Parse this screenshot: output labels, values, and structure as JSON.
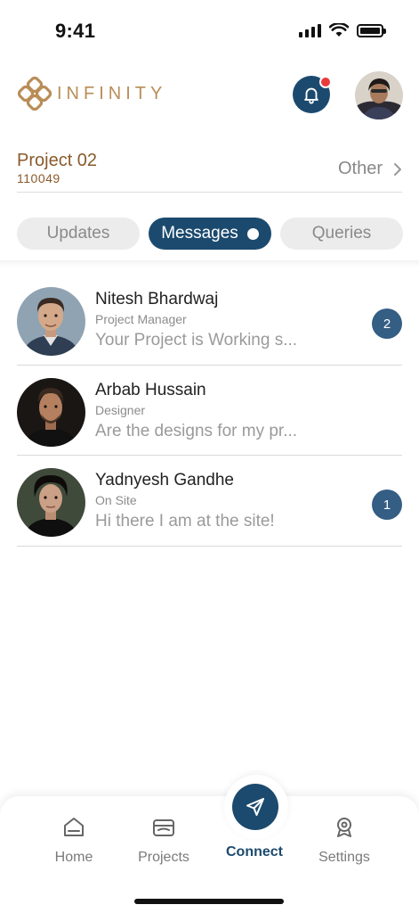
{
  "status_bar": {
    "time": "9:41"
  },
  "header": {
    "logo_text": "INFINITY",
    "notification_icon": "bell-icon",
    "has_notification": true
  },
  "project": {
    "name": "Project 02",
    "code": "110049",
    "other_label": "Other"
  },
  "tabs": [
    {
      "label": "Updates",
      "active": false
    },
    {
      "label": "Messages",
      "active": true
    },
    {
      "label": "Queries",
      "active": false
    }
  ],
  "messages": [
    {
      "name": "Nitesh Bhardwaj",
      "role": "Project Manager",
      "preview": "Your Project is Working s...",
      "unread": "2"
    },
    {
      "name": "Arbab Hussain",
      "role": "Designer",
      "preview": "Are the designs for my pr...",
      "unread": ""
    },
    {
      "name": "Yadnyesh Gandhe",
      "role": "On Site",
      "preview": "Hi there I am at the site!",
      "unread": "1"
    }
  ],
  "nav": {
    "home": "Home",
    "projects": "Projects",
    "connect": "Connect",
    "settings": "Settings",
    "active": "connect"
  },
  "colors": {
    "primary": "#1c4a6e",
    "brand_gold": "#b98d57",
    "project_brown": "#8a5a2b",
    "badge": "#355e85",
    "notification_dot": "#ea3b3b"
  }
}
